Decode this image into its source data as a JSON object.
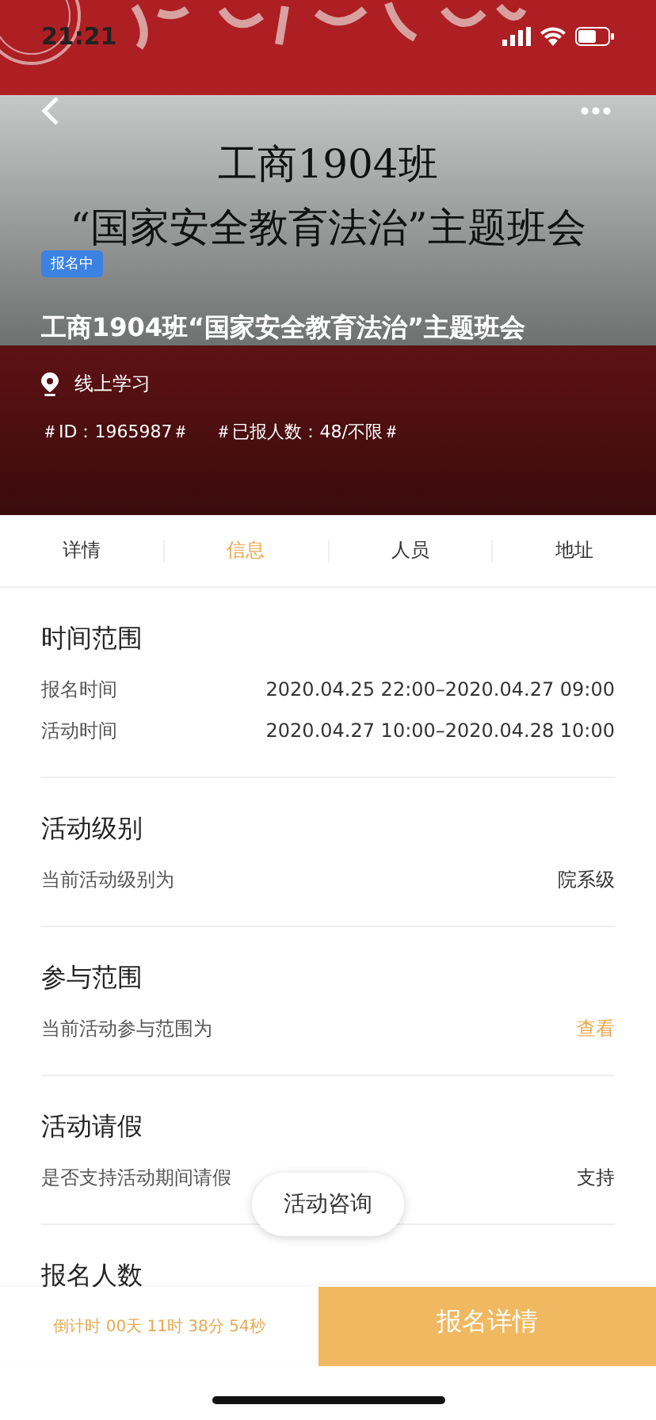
{
  "status_bar": {
    "time": "21:21"
  },
  "cover": {
    "title_lines": [
      "工商1904班",
      "“国家安全教育法治”主题班会"
    ]
  },
  "activity": {
    "status_tag": "报名中",
    "title": "工商1904班“国家安全教育法治”主题班会",
    "location": "线上学习",
    "tags": [
      "＃ID：1965987＃",
      "＃已报人数：48/不限＃"
    ]
  },
  "tabs": [
    {
      "label": "详情",
      "selected": false
    },
    {
      "label": "信息",
      "selected": true
    },
    {
      "label": "人员",
      "selected": false
    },
    {
      "label": "地址",
      "selected": false
    }
  ],
  "sections": [
    {
      "title": "时间范围",
      "rows": [
        {
          "label": "报名时间",
          "value": "2020.04.25 22:00–2020.04.27 09:00",
          "kind": "text"
        },
        {
          "label": "活动时间",
          "value": "2020.04.27 10:00–2020.04.28 10:00",
          "kind": "text"
        }
      ]
    },
    {
      "title": "活动级别",
      "rows": [
        {
          "label": "当前活动级别为",
          "value": "院系级",
          "kind": "text"
        }
      ]
    },
    {
      "title": "参与范围",
      "rows": [
        {
          "label": "当前活动参与范围为",
          "value": "查看",
          "kind": "link"
        }
      ]
    },
    {
      "title": "活动请假",
      "rows": [
        {
          "label": "是否支持活动期间请假",
          "value": "支持",
          "kind": "text"
        }
      ]
    },
    {
      "title": "报名人数"
    }
  ],
  "consult_button": "活动咨询",
  "bottom_bar": {
    "countdown": "倒计时 00天 11时 38分 54秒",
    "action": "报名详情"
  }
}
